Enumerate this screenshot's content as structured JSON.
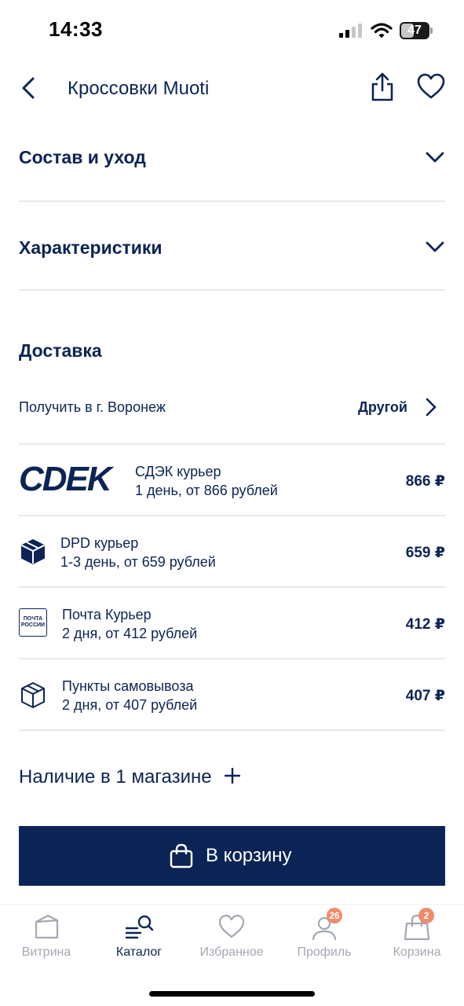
{
  "status_bar": {
    "time": "14:33",
    "battery_level": 47,
    "battery_text": "47",
    "icons": [
      "signal-icon",
      "wifi-icon",
      "battery-icon"
    ]
  },
  "header": {
    "title": "Кроссовки Muoti",
    "icons": [
      "back-arrow-icon",
      "share-icon",
      "heart-icon"
    ]
  },
  "accordions": [
    {
      "title": "Состав и уход"
    },
    {
      "title": "Характеристики"
    }
  ],
  "delivery": {
    "section_title": "Доставка",
    "city_label": "Получить в г. Воронеж",
    "change_label": "Другой",
    "options": [
      {
        "logo_text": "CDEK",
        "icon": "cdek-logo",
        "name": "СДЭК курьер",
        "desc": "1 день, от 866 рублей",
        "price": "866 ₽"
      },
      {
        "icon": "box-filled-icon",
        "name": "DPD курьер",
        "desc": "1-3 день, от 659 рублей",
        "price": "659 ₽"
      },
      {
        "logo_text_1": "ПОЧТА",
        "logo_text_2": "РОССИИ",
        "icon": "pochta-logo",
        "name": "Почта Курьер",
        "desc": "2 дня, от 412 рублей",
        "price": "412 ₽"
      },
      {
        "icon": "box-outline-icon",
        "name": "Пункты самовывоза",
        "desc": "2 дня, от 407 рублей",
        "price": "407 ₽"
      }
    ]
  },
  "availability": {
    "text": "Наличие в 1 магазине"
  },
  "cart_button": {
    "label": "В корзину"
  },
  "tab_bar": {
    "active_color": "#0b2455",
    "inactive_color": "#a3a8b3",
    "badge_color": "#f08b6a",
    "tabs": [
      {
        "label": "Витрина",
        "icon": "showcase-icon",
        "active": false
      },
      {
        "label": "Каталог",
        "icon": "catalog-search-icon",
        "active": true
      },
      {
        "label": "Избранное",
        "icon": "heart-icon",
        "active": false
      },
      {
        "label": "Профиль",
        "icon": "profile-icon",
        "active": false,
        "badge": "26"
      },
      {
        "label": "Корзина",
        "icon": "bag-icon",
        "active": false,
        "badge": "2"
      }
    ]
  },
  "colors": {
    "primary": "#0b2455",
    "divider": "#e7e9ee"
  }
}
